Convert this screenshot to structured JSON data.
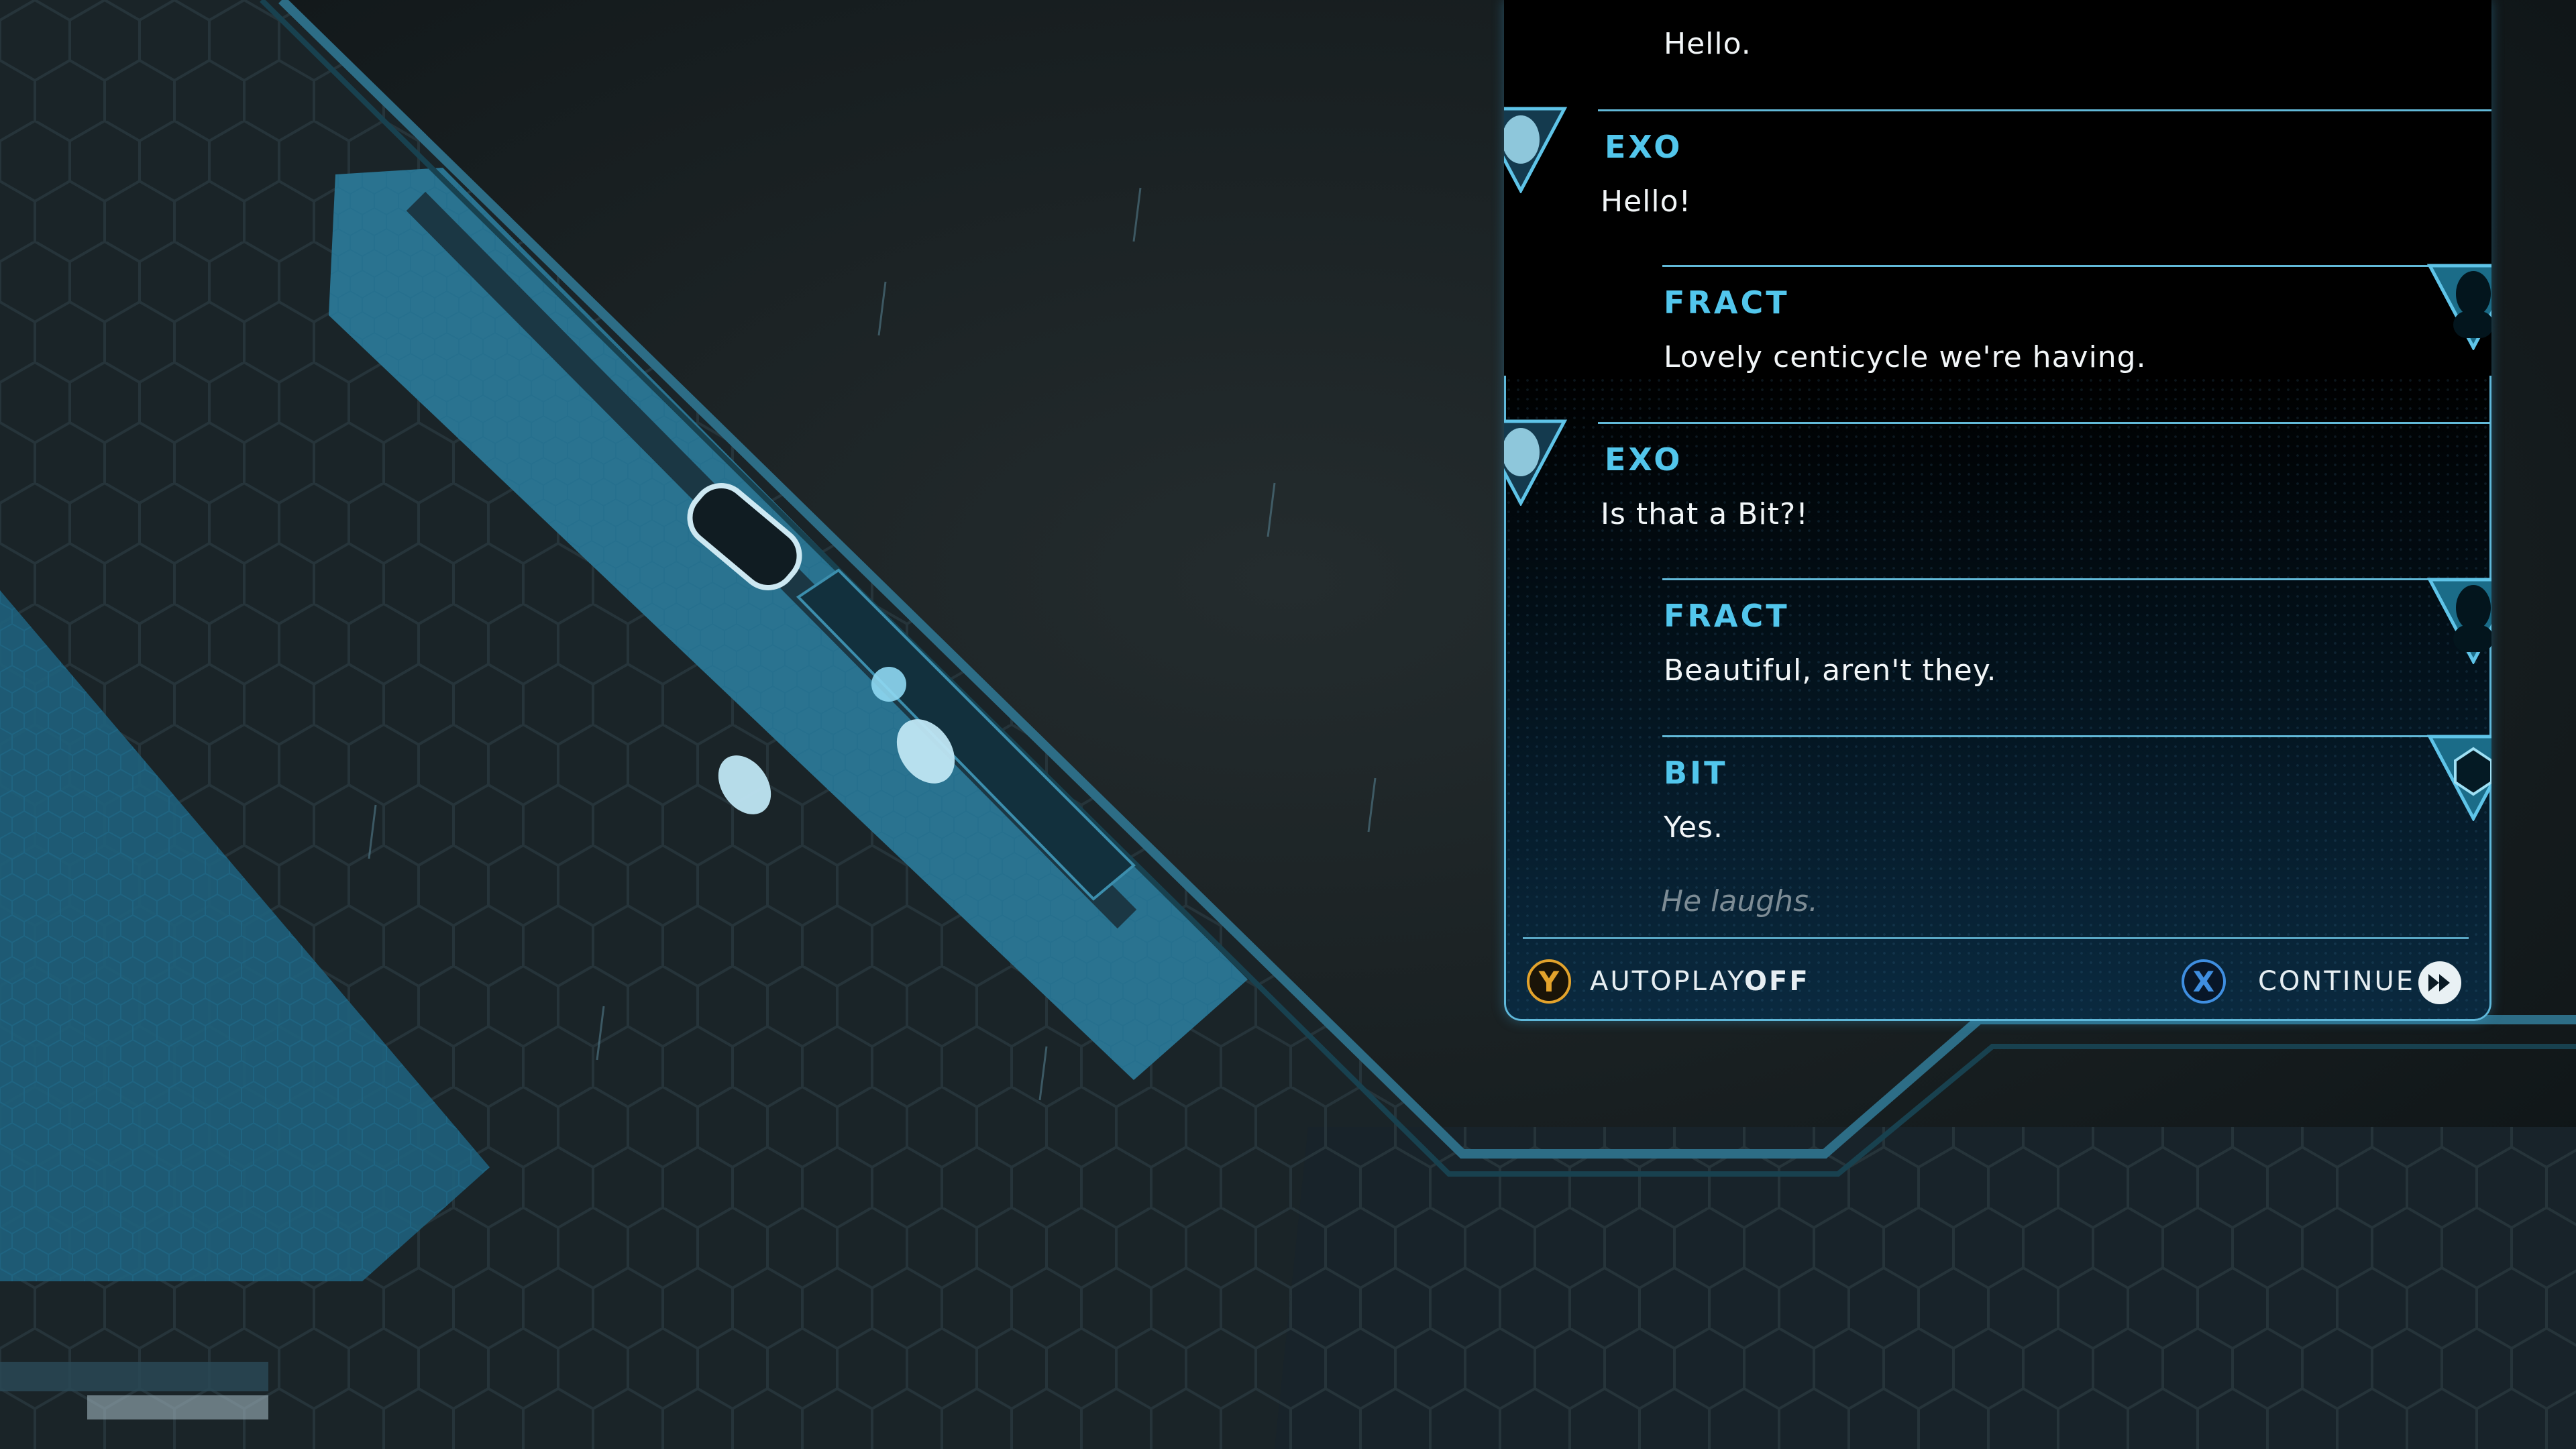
{
  "dialogue": {
    "partial_line": "Hello.",
    "entries": [
      {
        "speaker": "EXO",
        "text": "Hello!",
        "portrait_icon": "exo-portrait-icon"
      },
      {
        "speaker": "FRACT",
        "text": "Lovely centicycle we're having.",
        "portrait_icon": "fract-portrait-icon"
      },
      {
        "speaker": "EXO",
        "text": "Is that a Bit?!",
        "portrait_icon": "exo-portrait-icon"
      },
      {
        "speaker": "FRACT",
        "text": "Beautiful, aren't they.",
        "portrait_icon": "fract-portrait-icon"
      },
      {
        "speaker": "BIT",
        "text": "Yes.",
        "portrait_icon": "bit-portrait-icon"
      }
    ],
    "stage_direction": "He laughs."
  },
  "controls": {
    "autoplay_button": "Y",
    "autoplay_label": "AUTOPLAY",
    "autoplay_state": "OFF",
    "continue_button": "X",
    "continue_label": "CONTINUE",
    "continue_icon": "fast-forward-icon"
  },
  "colors": {
    "accent": "#52c6ec",
    "y_button": "#e3a32c",
    "x_button": "#3f8ee0"
  }
}
